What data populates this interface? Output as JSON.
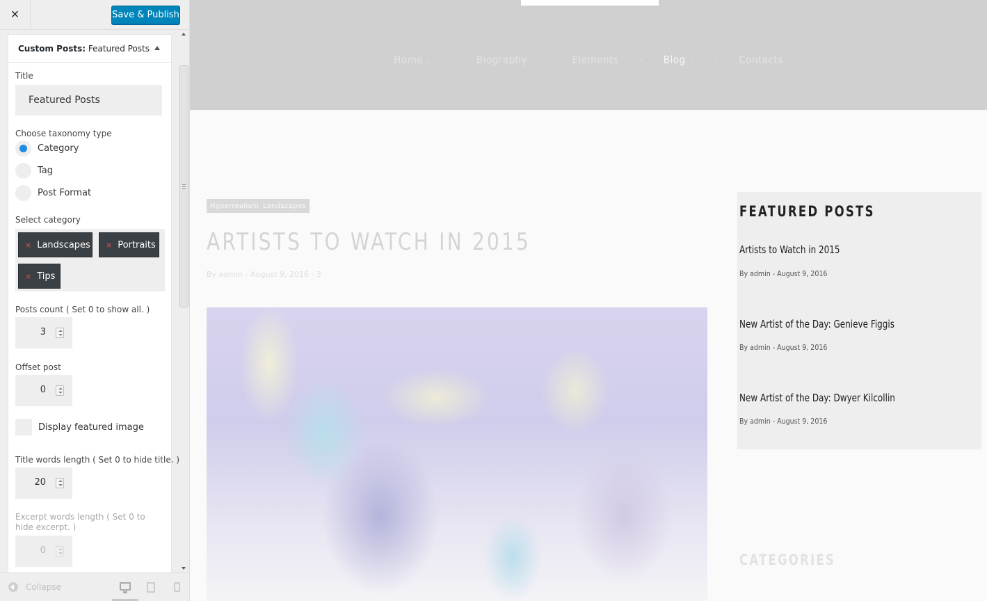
{
  "customizer": {
    "close_label": "×",
    "publish_label": "Save & Publish",
    "widget": {
      "title_prefix": "Custom Posts:",
      "title_name": "Featured Posts",
      "fields": {
        "title_label": "Title",
        "title_value": "Featured Posts",
        "taxonomy_label": "Choose taxonomy type",
        "taxonomy_options": [
          "Category",
          "Tag",
          "Post Format"
        ],
        "taxonomy_selected": "Category",
        "category_label": "Select category",
        "categories": [
          "Landscapes",
          "Portraits",
          "Tips"
        ],
        "posts_count_label": "Posts count ( Set 0 to show all. )",
        "posts_count_value": "3",
        "offset_label": "Offset post",
        "offset_value": "0",
        "display_image_label": "Display featured image",
        "display_image_checked": false,
        "title_words_label": "Title words length ( Set 0 to hide title. )",
        "title_words_value": "20",
        "excerpt_words_label": "Excerpt words length ( Set 0 to hide excerpt. )",
        "excerpt_words_value": "0"
      }
    },
    "footer": {
      "collapse_label": "Collapse",
      "devices": [
        "desktop",
        "tablet",
        "mobile"
      ],
      "active_device": "desktop"
    }
  },
  "preview": {
    "nav": [
      {
        "label": "Home",
        "has_caret": true,
        "active": false
      },
      {
        "label": "Biography",
        "has_caret": false,
        "active": false
      },
      {
        "label": "Elements",
        "has_caret": false,
        "active": false
      },
      {
        "label": "Blog",
        "has_caret": true,
        "active": true
      },
      {
        "label": "Contacts",
        "has_caret": false,
        "active": false
      }
    ],
    "nav_separator": "-",
    "nav_caret": "⌄",
    "post": {
      "tags": [
        "Hyperrealism",
        "Landscapes"
      ],
      "title": "ARTISTS TO WATCH IN 2015",
      "meta": "By admin - August 9, 2016 - 3"
    },
    "featured_widget": {
      "heading": "FEATURED POSTS",
      "posts": [
        {
          "title": "Artists to Watch in 2015",
          "meta": "By admin - August 9, 2016"
        },
        {
          "title": "New Artist of the Day: Genieve Figgis",
          "meta": "By admin - August 9, 2016"
        },
        {
          "title": "New Artist of the Day: Dwyer Kilcollin",
          "meta": "By admin - August 9, 2016"
        }
      ]
    },
    "categories_heading": "CATEGORIES"
  },
  "colors": {
    "accent": "#0085ba",
    "radio_selected": "#1e8cdf",
    "chip_background": "#3b4045",
    "chip_remove": "#e05050",
    "header_background": "#d0d0d0",
    "sidebar_widget_background": "#eeeeee"
  }
}
